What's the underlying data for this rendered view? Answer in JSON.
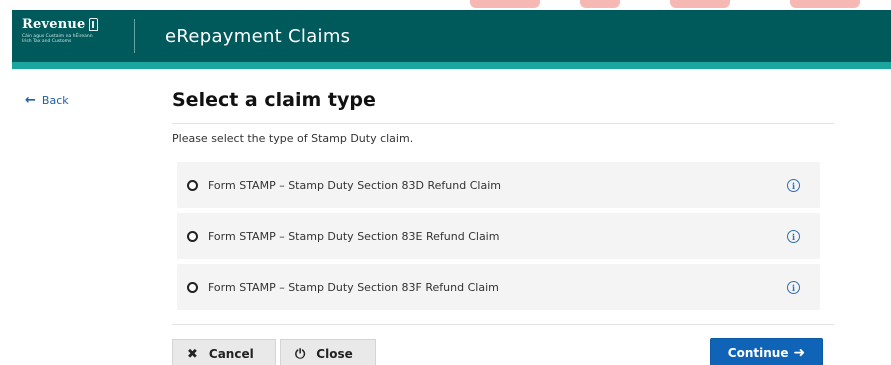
{
  "header": {
    "brand": "Revenue",
    "brand_tagline": "Cáin agus Custaim na hÉireann Irish Tax and Customs",
    "app_title": "eRepayment Claims"
  },
  "nav": {
    "back_label": "Back"
  },
  "main": {
    "title": "Select a claim type",
    "intro": "Please select the type of Stamp Duty claim.",
    "options": [
      {
        "label": "Form STAMP – Stamp Duty Section 83D Refund Claim",
        "selected": false
      },
      {
        "label": "Form STAMP – Stamp Duty Section 83E Refund Claim",
        "selected": false
      },
      {
        "label": "Form STAMP – Stamp Duty Section 83F Refund Claim",
        "selected": false
      }
    ]
  },
  "actions": {
    "cancel_label": "Cancel",
    "close_label": "Close",
    "continue_label": "Continue"
  },
  "colors": {
    "header_bg": "#00595b",
    "accent": "#1aa69e",
    "primary": "#0f64b8",
    "link": "#1f5fa6"
  }
}
